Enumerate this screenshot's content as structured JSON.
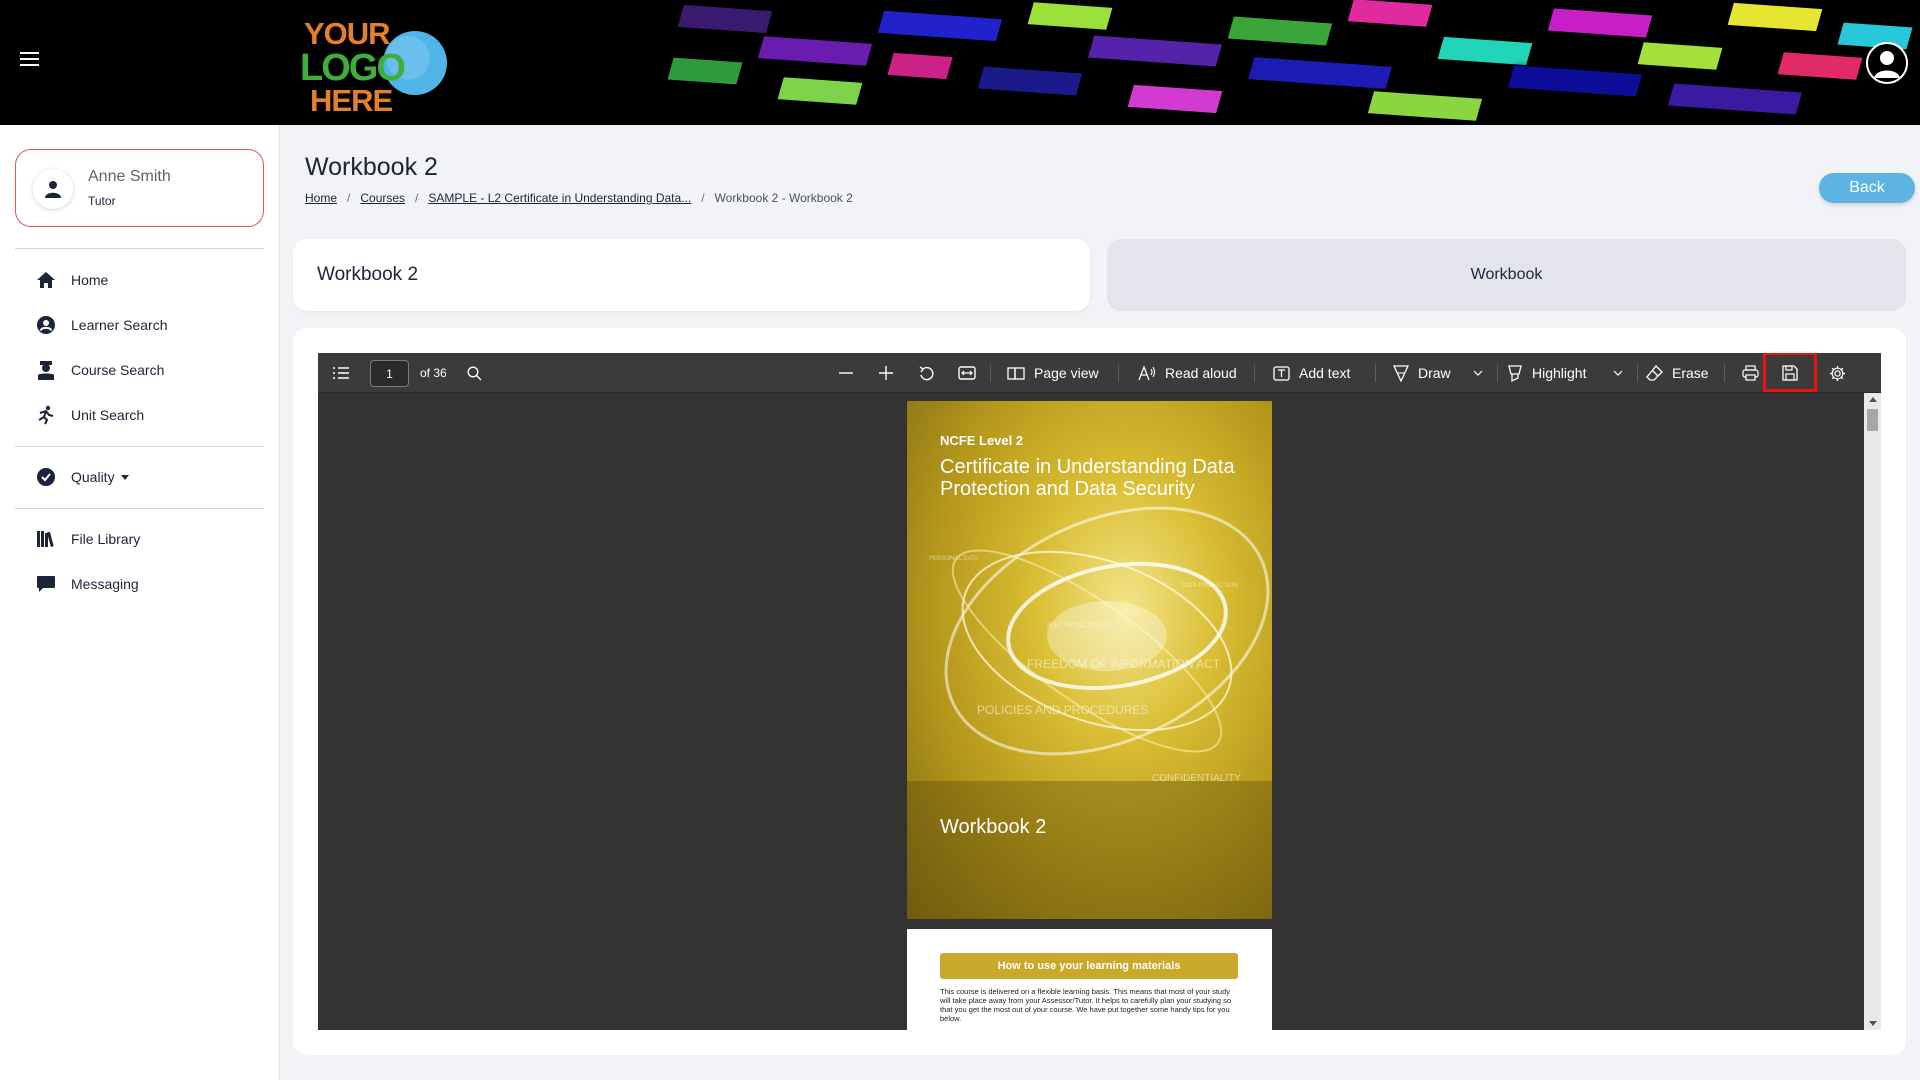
{
  "header": {
    "logo": {
      "line1": "YOUR",
      "line2": "LOGO",
      "line3": "HERE"
    },
    "colors": {
      "logo_orange": "#e5802a",
      "logo_green": "#3fae3a",
      "logo_blue": "#4fb4e6"
    }
  },
  "user": {
    "name": "Anne Smith",
    "role": "Tutor"
  },
  "sidebar": {
    "items": [
      {
        "label": "Home",
        "icon": "home-icon"
      },
      {
        "label": "Learner Search",
        "icon": "user-circle-icon"
      },
      {
        "label": "Course Search",
        "icon": "graduate-icon"
      },
      {
        "label": "Unit Search",
        "icon": "unit-search-icon"
      },
      {
        "label": "Quality",
        "icon": "check-circle-icon"
      },
      {
        "label": "File Library",
        "icon": "books-icon"
      },
      {
        "label": "Messaging",
        "icon": "chat-icon"
      }
    ]
  },
  "page": {
    "title": "Workbook 2",
    "back_label": "Back",
    "breadcrumb": [
      "Home",
      "Courses",
      "SAMPLE - L2 Certificate in Understanding Data...",
      "Workbook 2 - Workbook 2"
    ],
    "card_title": "Workbook 2",
    "tab_label": "Workbook"
  },
  "pdf": {
    "current_page": "1",
    "of_pages": "of 36",
    "toolbar": {
      "page_view": "Page view",
      "read_aloud": "Read aloud",
      "add_text": "Add text",
      "draw": "Draw",
      "highlight": "Highlight",
      "erase": "Erase"
    },
    "page1": {
      "level": "NCFE Level 2",
      "title": "Certificate in Understanding Data Protection and Data Security",
      "words": [
        "PERSONAL DATA",
        "DATA PROTECTION",
        "ELECTRONIC ACCESS",
        "FREEDOM OF INFORMATION ACT",
        "POLICIES AND PROCEDURES",
        "CONFIDENTIALITY"
      ],
      "workbook": "Workbook 2"
    },
    "page2": {
      "heading": "How to use your learning materials",
      "text": "This course is delivered on a flexible learning basis. This means that most of your study will take place away from your Assessor/Tutor. It helps to carefully plan your studying so that you get the most out of your course. We have put together some handy tips for you below."
    }
  },
  "colors": {
    "accent_blue": "#5db3e2",
    "user_card_border": "#e05a55",
    "highlight_red": "#ee1111",
    "viewer_bg": "#333333"
  }
}
